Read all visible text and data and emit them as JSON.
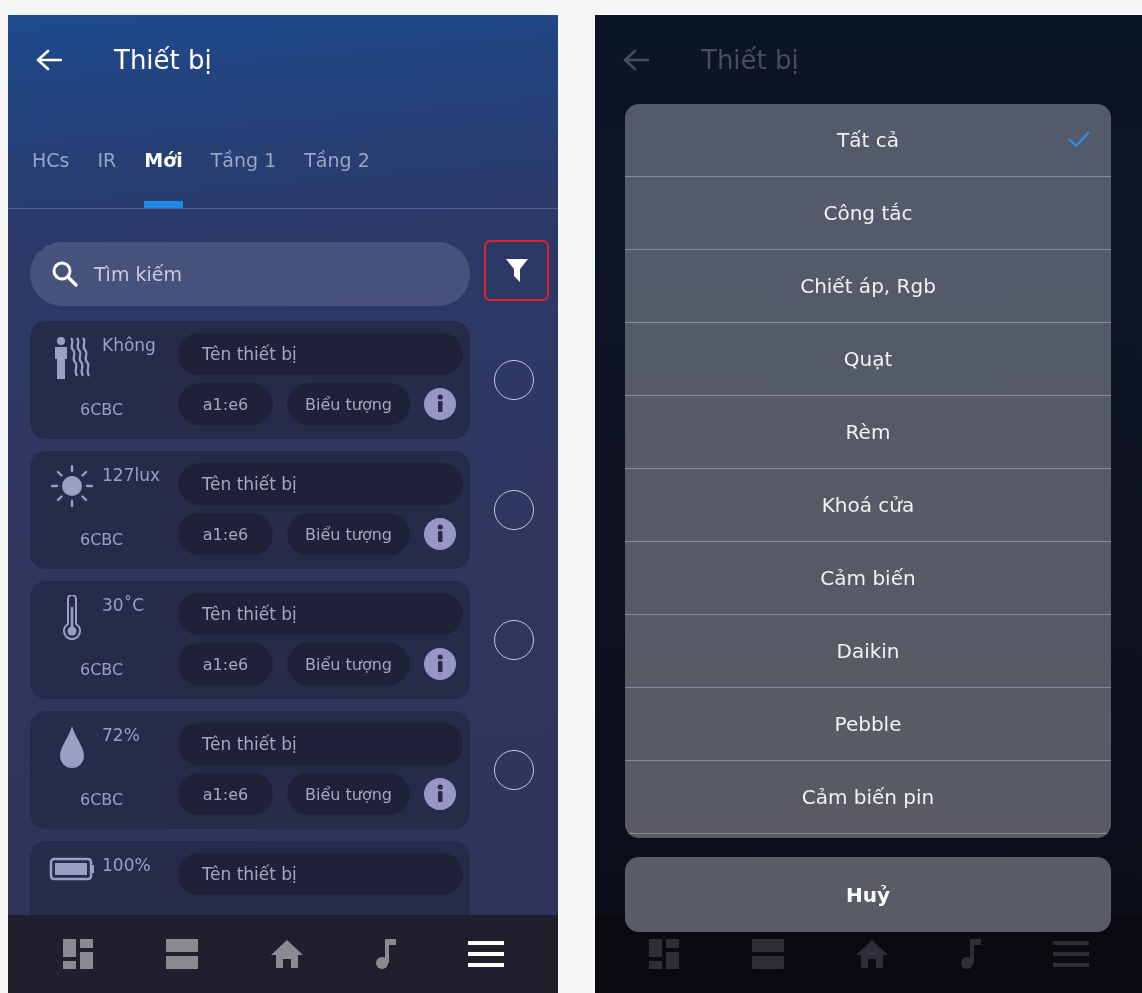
{
  "header": {
    "title": "Thiết bị"
  },
  "tabs": [
    {
      "label": "HCs",
      "selected": false
    },
    {
      "label": "IR",
      "selected": false
    },
    {
      "label": "Mới",
      "selected": true
    },
    {
      "label": "Tầng 1",
      "selected": false
    },
    {
      "label": "Tầng 2",
      "selected": false
    }
  ],
  "search": {
    "placeholder": "Tìm kiếm"
  },
  "filter_button": {
    "highlighted": true
  },
  "devices": [
    {
      "kind": "presence",
      "value": "Không",
      "id": "6CBC",
      "placeholder": "Tên thiết bị",
      "address": "a1:e6",
      "icon_label": "Biểu tượng",
      "selected": false
    },
    {
      "kind": "light",
      "value": "127lux",
      "id": "6CBC",
      "placeholder": "Tên thiết bị",
      "address": "a1:e6",
      "icon_label": "Biểu tượng",
      "selected": false
    },
    {
      "kind": "temperature",
      "value": "30˚C",
      "id": "6CBC",
      "placeholder": "Tên thiết bị",
      "address": "a1:e6",
      "icon_label": "Biểu tượng",
      "selected": false
    },
    {
      "kind": "humidity",
      "value": "72%",
      "id": "6CBC",
      "placeholder": "Tên thiết bị",
      "address": "a1:e6",
      "icon_label": "Biểu tượng",
      "selected": false
    },
    {
      "kind": "battery",
      "value": "100%",
      "placeholder": "Tên thiết bị"
    }
  ],
  "nav": [
    {
      "kind": "dashboard",
      "selected": false
    },
    {
      "kind": "list",
      "selected": false
    },
    {
      "kind": "home",
      "selected": false
    },
    {
      "kind": "music",
      "selected": false
    },
    {
      "kind": "menu",
      "selected": true
    }
  ],
  "overlay": {
    "header": {
      "title": "Thiết bị"
    },
    "options": [
      {
        "label": "Tất cả",
        "selected": true
      },
      {
        "label": "Công tắc",
        "selected": false
      },
      {
        "label": "Chiết áp, Rgb",
        "selected": false
      },
      {
        "label": "Quạt",
        "selected": false
      },
      {
        "label": "Rèm",
        "selected": false
      },
      {
        "label": "Khoá cửa",
        "selected": false
      },
      {
        "label": "Cảm biến",
        "selected": false
      },
      {
        "label": "Daikin",
        "selected": false
      },
      {
        "label": "Pebble",
        "selected": false
      },
      {
        "label": "Cảm biến pin",
        "selected": false
      }
    ],
    "cancel": "Huỷ"
  }
}
